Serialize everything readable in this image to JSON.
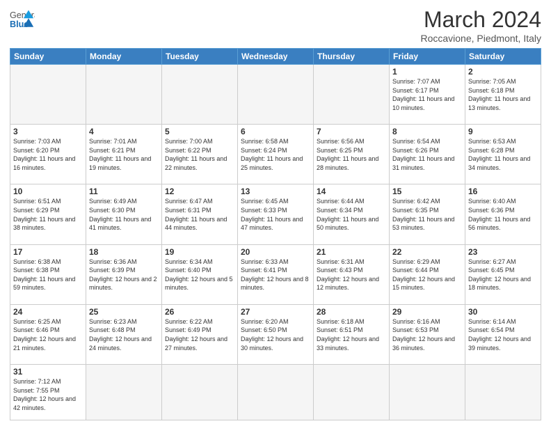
{
  "header": {
    "month_title": "March 2024",
    "location": "Roccavione, Piedmont, Italy",
    "logo_general": "General",
    "logo_blue": "Blue"
  },
  "weekdays": [
    "Sunday",
    "Monday",
    "Tuesday",
    "Wednesday",
    "Thursday",
    "Friday",
    "Saturday"
  ],
  "weeks": [
    [
      {
        "day": "",
        "info": ""
      },
      {
        "day": "",
        "info": ""
      },
      {
        "day": "",
        "info": ""
      },
      {
        "day": "",
        "info": ""
      },
      {
        "day": "",
        "info": ""
      },
      {
        "day": "1",
        "info": "Sunrise: 7:07 AM\nSunset: 6:17 PM\nDaylight: 11 hours and 10 minutes."
      },
      {
        "day": "2",
        "info": "Sunrise: 7:05 AM\nSunset: 6:18 PM\nDaylight: 11 hours and 13 minutes."
      }
    ],
    [
      {
        "day": "3",
        "info": "Sunrise: 7:03 AM\nSunset: 6:20 PM\nDaylight: 11 hours and 16 minutes."
      },
      {
        "day": "4",
        "info": "Sunrise: 7:01 AM\nSunset: 6:21 PM\nDaylight: 11 hours and 19 minutes."
      },
      {
        "day": "5",
        "info": "Sunrise: 7:00 AM\nSunset: 6:22 PM\nDaylight: 11 hours and 22 minutes."
      },
      {
        "day": "6",
        "info": "Sunrise: 6:58 AM\nSunset: 6:24 PM\nDaylight: 11 hours and 25 minutes."
      },
      {
        "day": "7",
        "info": "Sunrise: 6:56 AM\nSunset: 6:25 PM\nDaylight: 11 hours and 28 minutes."
      },
      {
        "day": "8",
        "info": "Sunrise: 6:54 AM\nSunset: 6:26 PM\nDaylight: 11 hours and 31 minutes."
      },
      {
        "day": "9",
        "info": "Sunrise: 6:53 AM\nSunset: 6:28 PM\nDaylight: 11 hours and 34 minutes."
      }
    ],
    [
      {
        "day": "10",
        "info": "Sunrise: 6:51 AM\nSunset: 6:29 PM\nDaylight: 11 hours and 38 minutes."
      },
      {
        "day": "11",
        "info": "Sunrise: 6:49 AM\nSunset: 6:30 PM\nDaylight: 11 hours and 41 minutes."
      },
      {
        "day": "12",
        "info": "Sunrise: 6:47 AM\nSunset: 6:31 PM\nDaylight: 11 hours and 44 minutes."
      },
      {
        "day": "13",
        "info": "Sunrise: 6:45 AM\nSunset: 6:33 PM\nDaylight: 11 hours and 47 minutes."
      },
      {
        "day": "14",
        "info": "Sunrise: 6:44 AM\nSunset: 6:34 PM\nDaylight: 11 hours and 50 minutes."
      },
      {
        "day": "15",
        "info": "Sunrise: 6:42 AM\nSunset: 6:35 PM\nDaylight: 11 hours and 53 minutes."
      },
      {
        "day": "16",
        "info": "Sunrise: 6:40 AM\nSunset: 6:36 PM\nDaylight: 11 hours and 56 minutes."
      }
    ],
    [
      {
        "day": "17",
        "info": "Sunrise: 6:38 AM\nSunset: 6:38 PM\nDaylight: 11 hours and 59 minutes."
      },
      {
        "day": "18",
        "info": "Sunrise: 6:36 AM\nSunset: 6:39 PM\nDaylight: 12 hours and 2 minutes."
      },
      {
        "day": "19",
        "info": "Sunrise: 6:34 AM\nSunset: 6:40 PM\nDaylight: 12 hours and 5 minutes."
      },
      {
        "day": "20",
        "info": "Sunrise: 6:33 AM\nSunset: 6:41 PM\nDaylight: 12 hours and 8 minutes."
      },
      {
        "day": "21",
        "info": "Sunrise: 6:31 AM\nSunset: 6:43 PM\nDaylight: 12 hours and 12 minutes."
      },
      {
        "day": "22",
        "info": "Sunrise: 6:29 AM\nSunset: 6:44 PM\nDaylight: 12 hours and 15 minutes."
      },
      {
        "day": "23",
        "info": "Sunrise: 6:27 AM\nSunset: 6:45 PM\nDaylight: 12 hours and 18 minutes."
      }
    ],
    [
      {
        "day": "24",
        "info": "Sunrise: 6:25 AM\nSunset: 6:46 PM\nDaylight: 12 hours and 21 minutes."
      },
      {
        "day": "25",
        "info": "Sunrise: 6:23 AM\nSunset: 6:48 PM\nDaylight: 12 hours and 24 minutes."
      },
      {
        "day": "26",
        "info": "Sunrise: 6:22 AM\nSunset: 6:49 PM\nDaylight: 12 hours and 27 minutes."
      },
      {
        "day": "27",
        "info": "Sunrise: 6:20 AM\nSunset: 6:50 PM\nDaylight: 12 hours and 30 minutes."
      },
      {
        "day": "28",
        "info": "Sunrise: 6:18 AM\nSunset: 6:51 PM\nDaylight: 12 hours and 33 minutes."
      },
      {
        "day": "29",
        "info": "Sunrise: 6:16 AM\nSunset: 6:53 PM\nDaylight: 12 hours and 36 minutes."
      },
      {
        "day": "30",
        "info": "Sunrise: 6:14 AM\nSunset: 6:54 PM\nDaylight: 12 hours and 39 minutes."
      }
    ],
    [
      {
        "day": "31",
        "info": "Sunrise: 7:12 AM\nSunset: 7:55 PM\nDaylight: 12 hours and 42 minutes."
      },
      {
        "day": "",
        "info": ""
      },
      {
        "day": "",
        "info": ""
      },
      {
        "day": "",
        "info": ""
      },
      {
        "day": "",
        "info": ""
      },
      {
        "day": "",
        "info": ""
      },
      {
        "day": "",
        "info": ""
      }
    ]
  ]
}
